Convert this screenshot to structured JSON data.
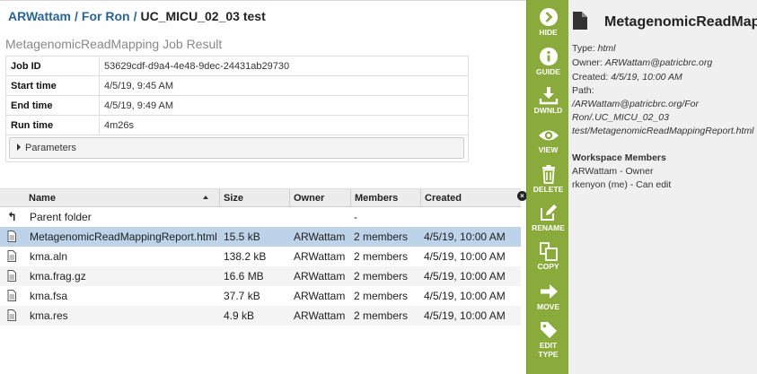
{
  "breadcrumb": {
    "items": [
      "ARWattam",
      "For Ron"
    ],
    "separator": "/",
    "current": "UC_MICU_02_03 test"
  },
  "job": {
    "title": "MetagenomicReadMapping Job Result",
    "fields": [
      {
        "label": "Job ID",
        "value": "53629cdf-d9a4-4e48-9dec-24431ab29730"
      },
      {
        "label": "Start time",
        "value": "4/5/19, 9:45 AM"
      },
      {
        "label": "End time",
        "value": "4/5/19, 9:49 AM"
      },
      {
        "label": "Run time",
        "value": "4m26s"
      }
    ],
    "parameters_label": "Parameters"
  },
  "grid": {
    "columns": {
      "name": "Name",
      "size": "Size",
      "owner": "Owner",
      "members": "Members",
      "created": "Created"
    },
    "close_glyph": "×",
    "parent_row": {
      "icon": "up-arrow-icon",
      "glyph": "↰",
      "name": "Parent folder",
      "members": "-"
    },
    "rows": [
      {
        "name": "MetagenomicReadMappingReport.html",
        "size": "15.5 kB",
        "owner": "ARWattam",
        "members": "2 members",
        "created": "4/5/19, 10:00 AM",
        "selected": true
      },
      {
        "name": "kma.aln",
        "size": "138.2 kB",
        "owner": "ARWattam",
        "members": "2 members",
        "created": "4/5/19, 10:00 AM"
      },
      {
        "name": "kma.frag.gz",
        "size": "16.6 MB",
        "owner": "ARWattam",
        "members": "2 members",
        "created": "4/5/19, 10:00 AM"
      },
      {
        "name": "kma.fsa",
        "size": "37.7 kB",
        "owner": "ARWattam",
        "members": "2 members",
        "created": "4/5/19, 10:00 AM"
      },
      {
        "name": "kma.res",
        "size": "4.9 kB",
        "owner": "ARWattam",
        "members": "2 members",
        "created": "4/5/19, 10:00 AM"
      }
    ]
  },
  "actions": [
    {
      "label": "HIDE",
      "icon": "chevron-right-circle-icon"
    },
    {
      "label": "GUIDE",
      "icon": "info-icon"
    },
    {
      "label": "DWNLD",
      "icon": "download-icon"
    },
    {
      "label": "VIEW",
      "icon": "eye-icon"
    },
    {
      "label": "DELETE",
      "icon": "trash-icon"
    },
    {
      "label": "RENAME",
      "icon": "pencil-icon"
    },
    {
      "label": "COPY",
      "icon": "copy-icon"
    },
    {
      "label": "MOVE",
      "icon": "arrow-right-icon"
    },
    {
      "label": "EDIT",
      "label2": "TYPE",
      "icon": "tag-icon"
    }
  ],
  "details": {
    "title": "MetagenomicReadMappingReport.html",
    "type_label": "Type:",
    "type_value": "html",
    "owner_label": "Owner:",
    "owner_value": "ARWattam@patricbrc.org",
    "created_label": "Created:",
    "created_value": "4/5/19, 10:00 AM",
    "path_label": "Path:",
    "path_lines": [
      "/ARWattam@patricbrc.org/For",
      "Ron/.UC_MICU_02_03",
      "test/MetagenomicReadMappingReport.html"
    ],
    "members_heading": "Workspace Members",
    "members": [
      "ARWattam - Owner",
      "rkenyon (me) - Can edit"
    ]
  },
  "colors": {
    "sidebar": "#8aab3b",
    "link": "#2a6496",
    "selected_row": "#bcd3ea"
  }
}
